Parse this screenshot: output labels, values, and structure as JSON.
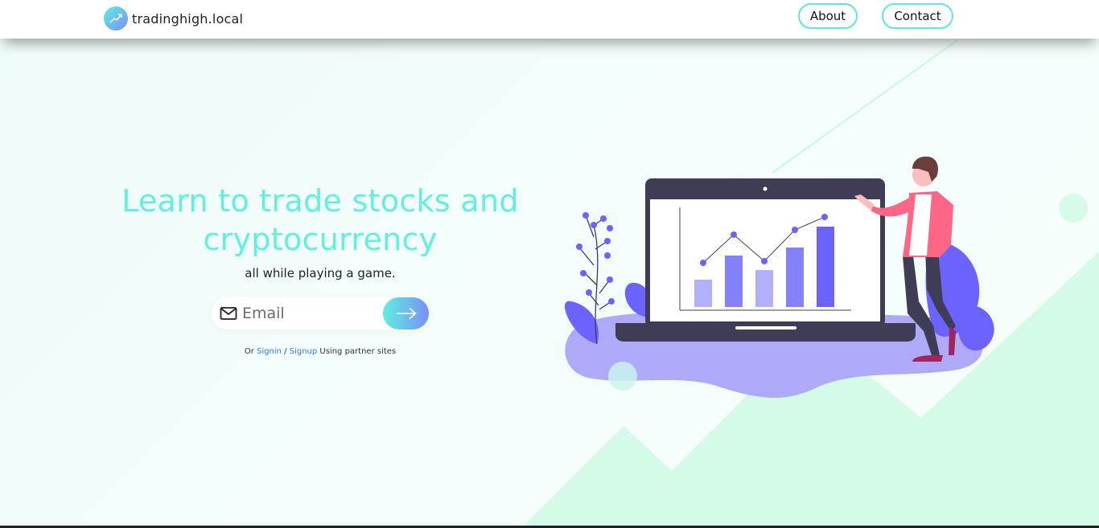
{
  "header": {
    "brand_name": "tradinghigh.local",
    "brand_icon": "trend-up-icon",
    "nav": [
      {
        "label": "About"
      },
      {
        "label": "Contact"
      }
    ]
  },
  "hero": {
    "title_line1": "Learn to trade stocks and",
    "title_line2": "cryptocurrency",
    "subtitle": "all while playing a game.",
    "email_placeholder": "Email",
    "submit_icon": "arrow-right-icon",
    "partner": {
      "prefix": "Or",
      "signin": "Signin",
      "separator": "/",
      "signup": "Signup",
      "suffix": "Using partner sites"
    }
  },
  "colors": {
    "accent": "#5ff1dd",
    "gradient_start": "#5ff0e0",
    "gradient_end": "#7a8ef5",
    "link": "#2a7fd8",
    "mountain": "#d3fbe8"
  }
}
